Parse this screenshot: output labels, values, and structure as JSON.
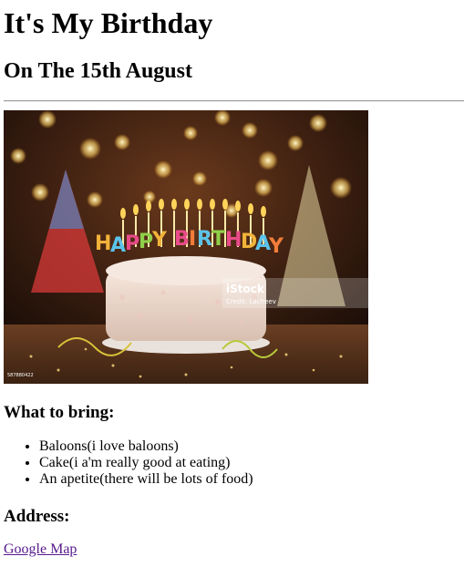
{
  "header": {
    "title": "It's My Birthday",
    "subtitle": "On The 15th August"
  },
  "image": {
    "banner_text": "HAPPY BIRTHDAY",
    "watermark_brand": "iStock",
    "watermark_credit": "Credit: Lacheev",
    "stock_id": "587880422"
  },
  "bring": {
    "heading": "What to bring:",
    "items": [
      "Baloons(i love baloons)",
      "Cake(i a'm really good at eating)",
      "An apetite(there will be lots of food)"
    ]
  },
  "address": {
    "heading": "Address:",
    "link_text": "Google Map"
  },
  "colors": {
    "link_visited": "#551a8b",
    "rule": "#9a9a9a"
  }
}
